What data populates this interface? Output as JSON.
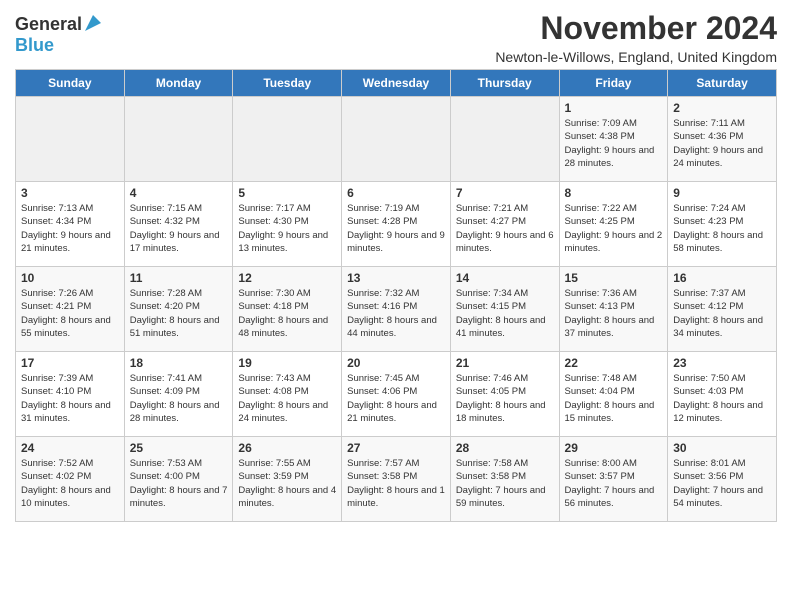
{
  "header": {
    "logo_general": "General",
    "logo_blue": "Blue",
    "month_title": "November 2024",
    "location": "Newton-le-Willows, England, United Kingdom"
  },
  "days_of_week": [
    "Sunday",
    "Monday",
    "Tuesday",
    "Wednesday",
    "Thursday",
    "Friday",
    "Saturday"
  ],
  "weeks": [
    [
      {
        "day": "",
        "info": ""
      },
      {
        "day": "",
        "info": ""
      },
      {
        "day": "",
        "info": ""
      },
      {
        "day": "",
        "info": ""
      },
      {
        "day": "",
        "info": ""
      },
      {
        "day": "1",
        "info": "Sunrise: 7:09 AM\nSunset: 4:38 PM\nDaylight: 9 hours and 28 minutes."
      },
      {
        "day": "2",
        "info": "Sunrise: 7:11 AM\nSunset: 4:36 PM\nDaylight: 9 hours and 24 minutes."
      }
    ],
    [
      {
        "day": "3",
        "info": "Sunrise: 7:13 AM\nSunset: 4:34 PM\nDaylight: 9 hours and 21 minutes."
      },
      {
        "day": "4",
        "info": "Sunrise: 7:15 AM\nSunset: 4:32 PM\nDaylight: 9 hours and 17 minutes."
      },
      {
        "day": "5",
        "info": "Sunrise: 7:17 AM\nSunset: 4:30 PM\nDaylight: 9 hours and 13 minutes."
      },
      {
        "day": "6",
        "info": "Sunrise: 7:19 AM\nSunset: 4:28 PM\nDaylight: 9 hours and 9 minutes."
      },
      {
        "day": "7",
        "info": "Sunrise: 7:21 AM\nSunset: 4:27 PM\nDaylight: 9 hours and 6 minutes."
      },
      {
        "day": "8",
        "info": "Sunrise: 7:22 AM\nSunset: 4:25 PM\nDaylight: 9 hours and 2 minutes."
      },
      {
        "day": "9",
        "info": "Sunrise: 7:24 AM\nSunset: 4:23 PM\nDaylight: 8 hours and 58 minutes."
      }
    ],
    [
      {
        "day": "10",
        "info": "Sunrise: 7:26 AM\nSunset: 4:21 PM\nDaylight: 8 hours and 55 minutes."
      },
      {
        "day": "11",
        "info": "Sunrise: 7:28 AM\nSunset: 4:20 PM\nDaylight: 8 hours and 51 minutes."
      },
      {
        "day": "12",
        "info": "Sunrise: 7:30 AM\nSunset: 4:18 PM\nDaylight: 8 hours and 48 minutes."
      },
      {
        "day": "13",
        "info": "Sunrise: 7:32 AM\nSunset: 4:16 PM\nDaylight: 8 hours and 44 minutes."
      },
      {
        "day": "14",
        "info": "Sunrise: 7:34 AM\nSunset: 4:15 PM\nDaylight: 8 hours and 41 minutes."
      },
      {
        "day": "15",
        "info": "Sunrise: 7:36 AM\nSunset: 4:13 PM\nDaylight: 8 hours and 37 minutes."
      },
      {
        "day": "16",
        "info": "Sunrise: 7:37 AM\nSunset: 4:12 PM\nDaylight: 8 hours and 34 minutes."
      }
    ],
    [
      {
        "day": "17",
        "info": "Sunrise: 7:39 AM\nSunset: 4:10 PM\nDaylight: 8 hours and 31 minutes."
      },
      {
        "day": "18",
        "info": "Sunrise: 7:41 AM\nSunset: 4:09 PM\nDaylight: 8 hours and 28 minutes."
      },
      {
        "day": "19",
        "info": "Sunrise: 7:43 AM\nSunset: 4:08 PM\nDaylight: 8 hours and 24 minutes."
      },
      {
        "day": "20",
        "info": "Sunrise: 7:45 AM\nSunset: 4:06 PM\nDaylight: 8 hours and 21 minutes."
      },
      {
        "day": "21",
        "info": "Sunrise: 7:46 AM\nSunset: 4:05 PM\nDaylight: 8 hours and 18 minutes."
      },
      {
        "day": "22",
        "info": "Sunrise: 7:48 AM\nSunset: 4:04 PM\nDaylight: 8 hours and 15 minutes."
      },
      {
        "day": "23",
        "info": "Sunrise: 7:50 AM\nSunset: 4:03 PM\nDaylight: 8 hours and 12 minutes."
      }
    ],
    [
      {
        "day": "24",
        "info": "Sunrise: 7:52 AM\nSunset: 4:02 PM\nDaylight: 8 hours and 10 minutes."
      },
      {
        "day": "25",
        "info": "Sunrise: 7:53 AM\nSunset: 4:00 PM\nDaylight: 8 hours and 7 minutes."
      },
      {
        "day": "26",
        "info": "Sunrise: 7:55 AM\nSunset: 3:59 PM\nDaylight: 8 hours and 4 minutes."
      },
      {
        "day": "27",
        "info": "Sunrise: 7:57 AM\nSunset: 3:58 PM\nDaylight: 8 hours and 1 minute."
      },
      {
        "day": "28",
        "info": "Sunrise: 7:58 AM\nSunset: 3:58 PM\nDaylight: 7 hours and 59 minutes."
      },
      {
        "day": "29",
        "info": "Sunrise: 8:00 AM\nSunset: 3:57 PM\nDaylight: 7 hours and 56 minutes."
      },
      {
        "day": "30",
        "info": "Sunrise: 8:01 AM\nSunset: 3:56 PM\nDaylight: 7 hours and 54 minutes."
      }
    ]
  ]
}
